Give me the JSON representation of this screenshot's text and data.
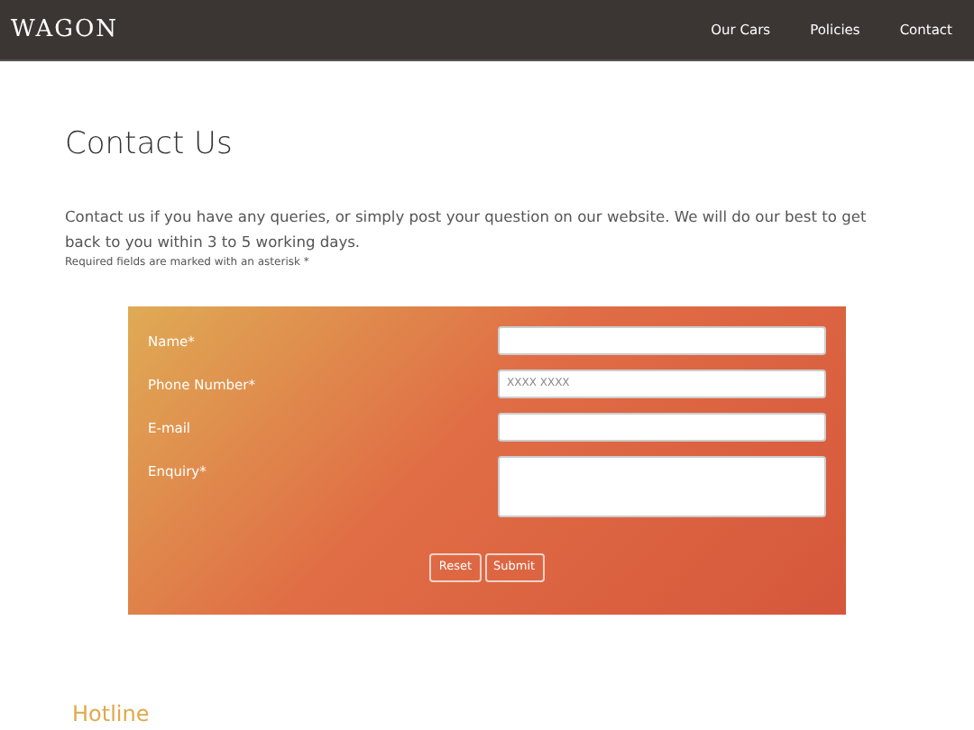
{
  "header": {
    "logo": "WAGON",
    "nav": [
      {
        "label": "Our Cars"
      },
      {
        "label": "Policies"
      },
      {
        "label": "Contact"
      }
    ]
  },
  "page": {
    "title": "Contact Us",
    "intro": "Contact us if you have any queries, or simply post your question on our website. We will do our best to get back to you within 3 to 5 working days.",
    "note": "Required fields are marked with an asterisk *"
  },
  "form": {
    "fields": [
      {
        "label": "Name*",
        "kind": "input"
      },
      {
        "label": "Phone Number*",
        "kind": "input",
        "placeholder": "XXXX XXXX"
      },
      {
        "label": "E-mail",
        "kind": "input"
      },
      {
        "label": "Enquiry*",
        "kind": "textarea"
      }
    ],
    "buttons": [
      "Reset",
      "Submit"
    ]
  },
  "hotline": {
    "title": "Hotline"
  }
}
